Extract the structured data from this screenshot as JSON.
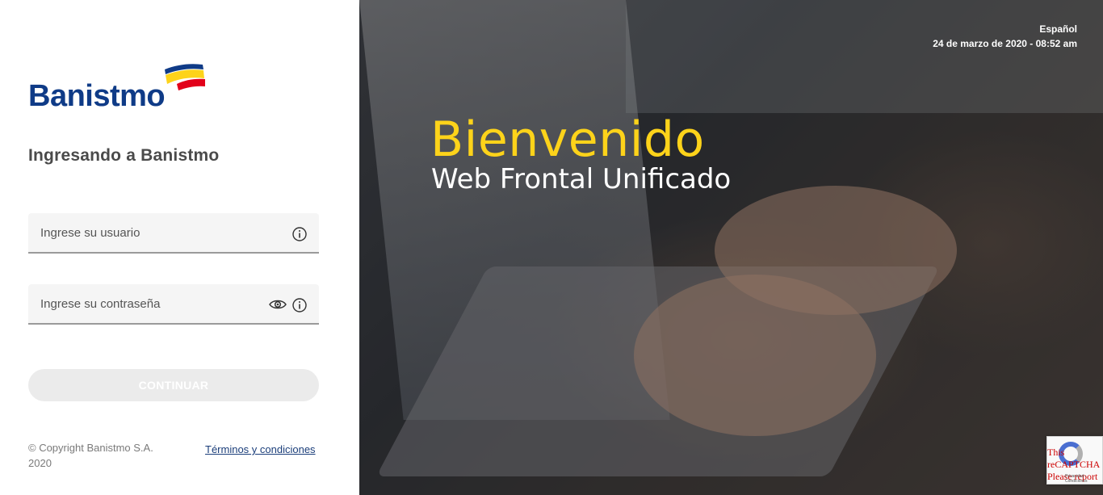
{
  "brand": {
    "name": "Banistmo",
    "colors": {
      "primary": "#0f3b87",
      "yellow": "#fdd31a",
      "red": "#e2001a"
    }
  },
  "login": {
    "title": "Ingresando a Banistmo",
    "username_placeholder": "Ingrese su usuario",
    "password_placeholder": "Ingrese su contraseña",
    "continue_label": "CONTINUAR",
    "info_icon": "info-circle-icon",
    "eye_icon": "eye-icon"
  },
  "footer": {
    "copyright": "© Copyright Banistmo S.A. 2020",
    "terms_label": "Términos y condiciones"
  },
  "hero": {
    "language": "Español",
    "datetime": "24 de marzo de 2020 - 08:52 am",
    "welcome": "Bienvenido",
    "subtitle": "Web Frontal Unificado"
  },
  "captcha": {
    "message": "This reCAPTCHA Please report this.",
    "footer": "Privacidad - Condiciones"
  }
}
